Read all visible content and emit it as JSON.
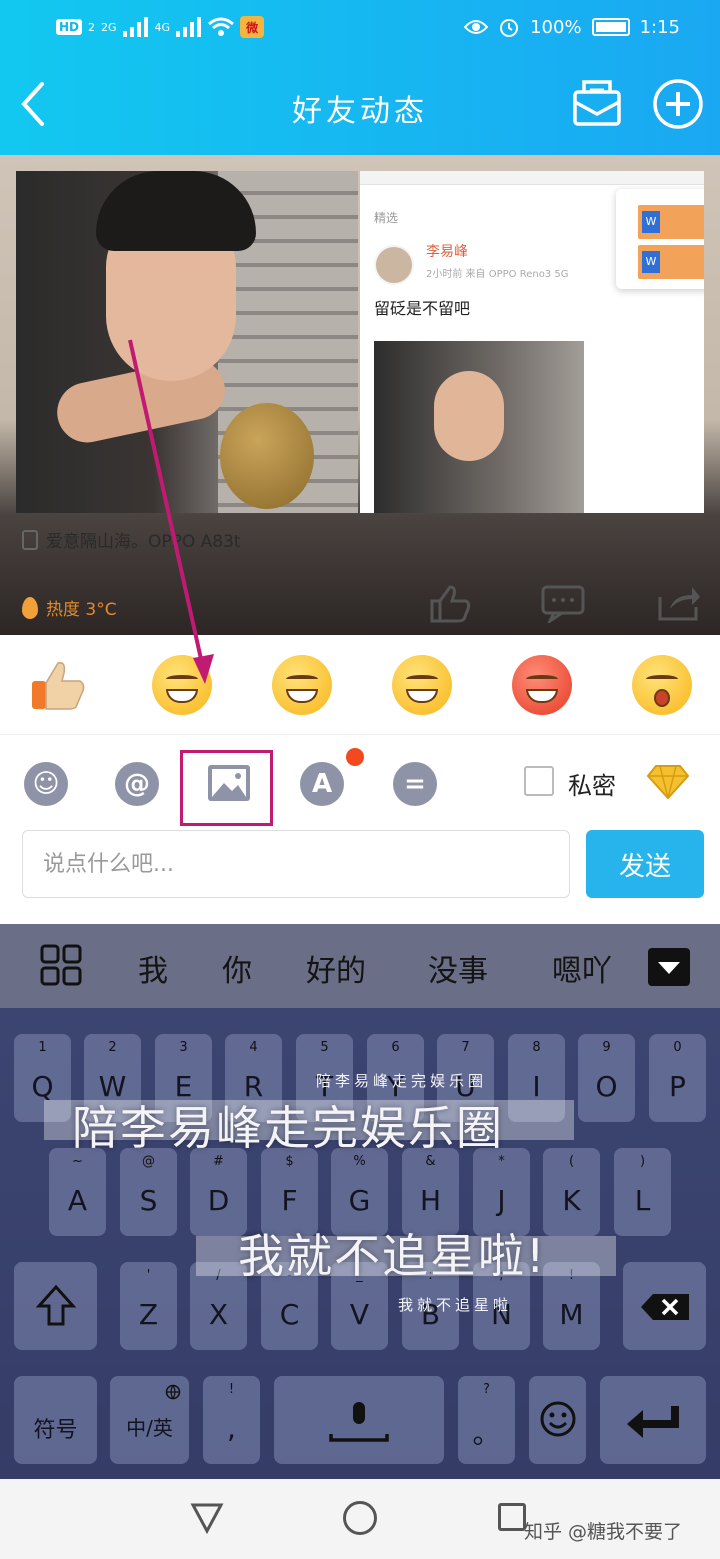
{
  "status_bar": {
    "hd": "HD",
    "hd_sub": "2",
    "net1": "2G",
    "net2": "4G",
    "battery": "100%",
    "time": "1:15"
  },
  "header": {
    "title": "好友动态"
  },
  "feed": {
    "screenshot": {
      "tag": "精选",
      "name": "李易峰",
      "meta": "2小时前 来自 OPPO Reno3 5G",
      "text": "留砭是不留吧"
    },
    "caption": "爱意隔山海。OPPO A83t",
    "heat": "热度 3°C"
  },
  "toolbar": {
    "private_label": "私密"
  },
  "composer": {
    "placeholder": "说点什么吧...",
    "value": "",
    "send_label": "发送"
  },
  "candidates": [
    "我",
    "你",
    "好的",
    "没事",
    "嗯吖"
  ],
  "keyboard": {
    "row1": [
      {
        "main": "Q",
        "sub": "1"
      },
      {
        "main": "W",
        "sub": "2"
      },
      {
        "main": "E",
        "sub": "3"
      },
      {
        "main": "R",
        "sub": "4"
      },
      {
        "main": "T",
        "sub": "5"
      },
      {
        "main": "Y",
        "sub": "6"
      },
      {
        "main": "U",
        "sub": "7"
      },
      {
        "main": "I",
        "sub": "8"
      },
      {
        "main": "O",
        "sub": "9"
      },
      {
        "main": "P",
        "sub": "0"
      }
    ],
    "row2": [
      {
        "main": "A",
        "sub": "~"
      },
      {
        "main": "S",
        "sub": "@"
      },
      {
        "main": "D",
        "sub": "#"
      },
      {
        "main": "F",
        "sub": "$"
      },
      {
        "main": "G",
        "sub": "%"
      },
      {
        "main": "H",
        "sub": "&"
      },
      {
        "main": "J",
        "sub": "*"
      },
      {
        "main": "K",
        "sub": "("
      },
      {
        "main": "L",
        "sub": ")"
      }
    ],
    "row3": [
      {
        "main": "Z",
        "sub": "'"
      },
      {
        "main": "X",
        "sub": "/"
      },
      {
        "main": "C",
        "sub": "-"
      },
      {
        "main": "V",
        "sub": "_"
      },
      {
        "main": "B",
        "sub": ":"
      },
      {
        "main": "N",
        "sub": ";"
      },
      {
        "main": "M",
        "sub": "!"
      }
    ],
    "symbols_label": "符号",
    "lang_label": "中/英",
    "comma": ",",
    "comma_sub": "!",
    "period": "。",
    "period_sub": "?",
    "overlay_big1": "陪李易峰走完娱乐圈",
    "overlay_small1": "陪李易峰走完娱乐圈",
    "overlay_big2": "我就不追星啦!",
    "overlay_small2": "我就不追星啦"
  },
  "watermark": "知乎 @糖我不要了",
  "colors": {
    "header_gradient_start": "#12c8f0",
    "header_gradient_end": "#1aa8f2",
    "send_button": "#27b4ec",
    "highlight": "#c11a73",
    "keyboard_bg": "#3c4471"
  }
}
